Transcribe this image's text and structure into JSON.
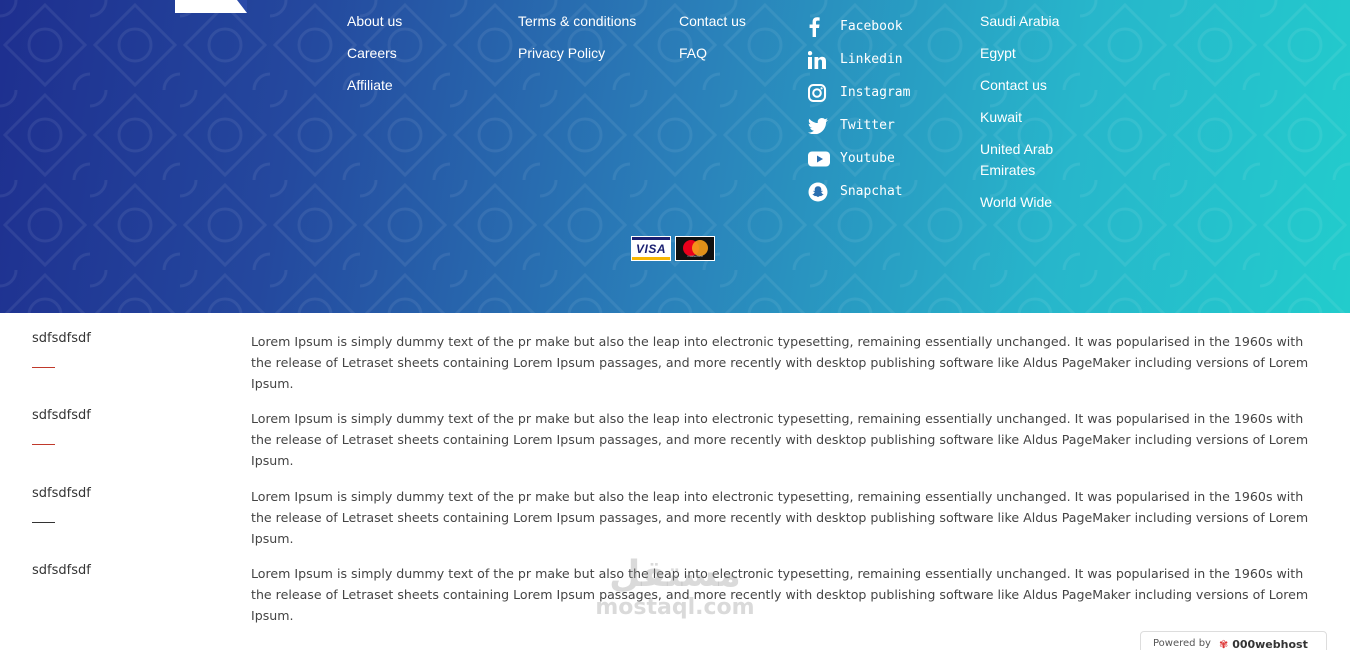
{
  "footer": {
    "col1": [
      "About us",
      "Careers",
      "Affiliate"
    ],
    "col2": [
      "Terms & conditions",
      "Privacy Policy"
    ],
    "col3": [
      "Contact us",
      "FAQ"
    ],
    "social": [
      {
        "icon": "facebook-icon",
        "label": "Facebook"
      },
      {
        "icon": "linkedin-icon",
        "label": "Linkedin"
      },
      {
        "icon": "instagram-icon",
        "label": "Instagram"
      },
      {
        "icon": "twitter-icon",
        "label": "Twitter"
      },
      {
        "icon": "youtube-icon",
        "label": "Youtube"
      },
      {
        "icon": "snapchat-icon",
        "label": "Snapchat"
      }
    ],
    "regions": [
      "Saudi Arabia",
      "Egypt",
      "Contact us",
      "Kuwait",
      "United Arab Emirates",
      "World Wide"
    ],
    "payments": {
      "visa": "VISA",
      "mastercard_text": "mastercard"
    }
  },
  "faq": [
    {
      "question": "sdfsdfsdf",
      "answer": "Lorem Ipsum is simply dummy text of the pr make but also the leap into electronic typesetting, remaining essentially unchanged. It was popularised in the 1960s with the release of Letraset sheets containing Lorem Ipsum passages, and more recently with desktop publishing software like Aldus PageMaker including versions of Lorem Ipsum."
    },
    {
      "question": "sdfsdfsdf",
      "answer": "Lorem Ipsum is simply dummy text of the pr make but also the leap into electronic typesetting, remaining essentially unchanged. It was popularised in the 1960s with the release of Letraset sheets containing Lorem Ipsum passages, and more recently with desktop publishing software like Aldus PageMaker including versions of Lorem Ipsum."
    },
    {
      "question": "sdfsdfsdf",
      "answer": "Lorem Ipsum is simply dummy text of the pr make but also the leap into electronic typesetting, remaining essentially unchanged. It was popularised in the 1960s with the release of Letraset sheets containing Lorem Ipsum passages, and more recently with desktop publishing software like Aldus PageMaker including versions of Lorem Ipsum."
    },
    {
      "question": "sdfsdfsdf",
      "answer": "Lorem Ipsum is simply dummy text of the pr make but also the leap into electronic typesetting, remaining essentially unchanged. It was popularised in the 1960s with the release of Letraset sheets containing Lorem Ipsum passages, and more recently with desktop publishing software like Aldus PageMaker including versions of Lorem Ipsum."
    }
  ],
  "watermark": {
    "arabic": "مستقل",
    "latin": "mostaql.com"
  },
  "powered": {
    "prefix": "Powered by",
    "brand": "000webhost"
  }
}
